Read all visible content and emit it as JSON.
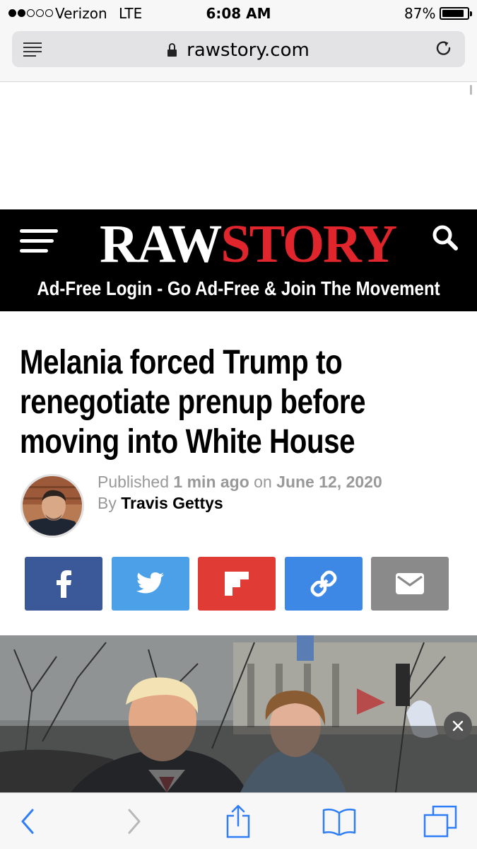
{
  "status_bar": {
    "carrier": "Verizon",
    "network": "LTE",
    "time": "6:08 AM",
    "battery_percent_text": "87%",
    "battery_level": 0.87,
    "signal_bars_filled": 2,
    "signal_bars_total": 5
  },
  "browser": {
    "url": "rawstory.com"
  },
  "site": {
    "logo_part1": "RAW",
    "logo_part2": "STORY",
    "tagline": "Ad-Free Login - Go Ad-Free & Join The Movement",
    "brand_color": "#e0252d"
  },
  "article": {
    "headline_lines": [
      "Melania forced Trump to",
      "renegotiate prenup before",
      "moving into White House"
    ],
    "published_prefix": "Published",
    "published_relative": "1 min ago",
    "published_on": "on",
    "published_date": "June 12, 2020",
    "by_prefix": "By",
    "author": "Travis Gettys"
  },
  "share_buttons": [
    {
      "name": "facebook",
      "icon": "facebook-icon",
      "color": "#3b5998"
    },
    {
      "name": "twitter",
      "icon": "twitter-icon",
      "color": "#4ca0e8"
    },
    {
      "name": "flipboard",
      "icon": "flipboard-icon",
      "color": "#e03b35"
    },
    {
      "name": "copy-link",
      "icon": "link-icon",
      "color": "#3d88e4"
    },
    {
      "name": "email",
      "icon": "email-icon",
      "color": "#8a8a8a"
    }
  ],
  "toolbar_icons": [
    "back-icon",
    "forward-icon",
    "share-icon",
    "bookmarks-icon",
    "tabs-icon"
  ]
}
